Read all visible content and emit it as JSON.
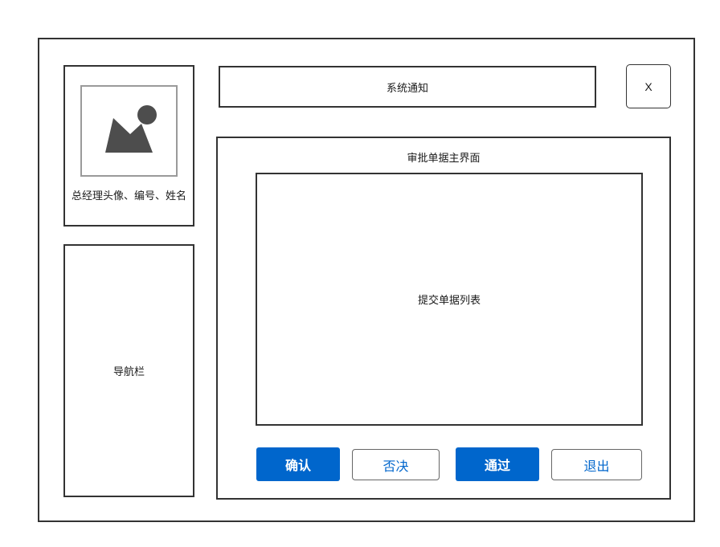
{
  "colors": {
    "accent": "#0066cc",
    "border": "#333333",
    "avatar_fill": "#4d4d4d"
  },
  "profile": {
    "avatar_icon": "image-placeholder-icon",
    "label": "总经理头像、编号、姓名"
  },
  "nav": {
    "label": "导航栏"
  },
  "notice": {
    "label": "系统通知"
  },
  "close": {
    "label": "X"
  },
  "main": {
    "title": "审批单据主界面",
    "list_label": "提交单据列表"
  },
  "actions": {
    "confirm": "确认",
    "reject": "否决",
    "approve": "通过",
    "exit": "退出"
  }
}
